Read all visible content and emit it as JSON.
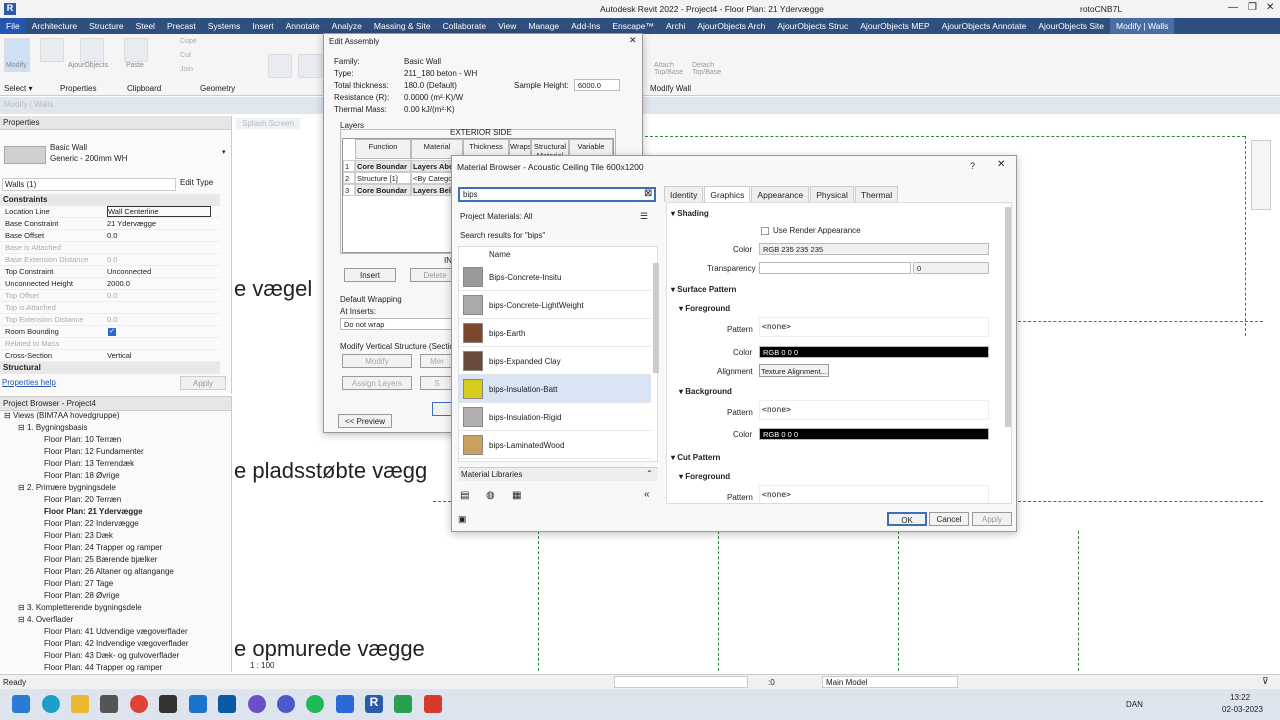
{
  "window": {
    "title": "Autodesk Revit 2022 - Project4 - Floor Plan: 21 Ydervægge",
    "user": "rotoCNB7L"
  },
  "ribbon_tabs": [
    "File",
    "Architecture",
    "Structure",
    "Steel",
    "Precast",
    "Systems",
    "Insert",
    "Annotate",
    "Analyze",
    "Massing & Site",
    "Collaborate",
    "View",
    "Manage",
    "Add-Ins",
    "Enscape™",
    "Archi",
    "AjourObjects Arch",
    "AjourObjects Struc",
    "AjourObjects MEP",
    "AjourObjects Annotate",
    "AjourObjects Site",
    "Modify | Walls"
  ],
  "ribbon_panels": {
    "select": "Select ▾",
    "properties": "Properties",
    "clipboard": "Clipboard",
    "geometry": "Geometry",
    "modify_wall": "Modify Wall",
    "modify": "Modify",
    "ajour": "AjourObjects",
    "paste": "Paste",
    "cope": "Cope",
    "cut": "Cut",
    "join": "Join",
    "attach": "Attach Top/Base",
    "detach": "Detach Top/Base"
  },
  "context_bar": "Modify | Walls",
  "properties": {
    "header": "Properties",
    "type_name": "Basic Wall",
    "type_sub": "Generic - 200mm WH",
    "selector": "Walls (1)",
    "edit_type": "Edit Type",
    "section_constraints": "Constraints",
    "rows": [
      {
        "k": "Location Line",
        "v": "Wall Centerline",
        "dis": false
      },
      {
        "k": "Base Constraint",
        "v": "21 Ydervægge",
        "dis": false
      },
      {
        "k": "Base Offset",
        "v": "0.0",
        "dis": false
      },
      {
        "k": "Base is Attached",
        "v": "",
        "dis": true
      },
      {
        "k": "Base Extension Distance",
        "v": "0.0",
        "dis": true
      },
      {
        "k": "Top Constraint",
        "v": "Unconnected",
        "dis": false
      },
      {
        "k": "Unconnected Height",
        "v": "2000.0",
        "dis": false
      },
      {
        "k": "Top Offset",
        "v": "0.0",
        "dis": true
      },
      {
        "k": "Top is Attached",
        "v": "",
        "dis": true
      },
      {
        "k": "Top Extension Distance",
        "v": "0.0",
        "dis": true
      },
      {
        "k": "Room Bounding",
        "v": "",
        "dis": false
      },
      {
        "k": "Related to Mass",
        "v": "",
        "dis": true
      },
      {
        "k": "Cross-Section",
        "v": "Vertical",
        "dis": false
      }
    ],
    "section_structural": "Structural",
    "help": "Properties help",
    "apply": "Apply"
  },
  "browser": {
    "header": "Project Browser - Project4",
    "root": "Views (BIM7AA hovedgruppe)",
    "items": [
      {
        "t": "1. Bygningsbasis",
        "lvl": 1
      },
      {
        "t": "Floor Plan: 10 Terræn",
        "lvl": 2
      },
      {
        "t": "Floor Plan: 12 Fundamenter",
        "lvl": 2
      },
      {
        "t": "Floor Plan: 13 Terrendæk",
        "lvl": 2
      },
      {
        "t": "Floor Plan: 18 Øvrige",
        "lvl": 2
      },
      {
        "t": "2. Primære bygningsdele",
        "lvl": 1
      },
      {
        "t": "Floor Plan: 20 Terræn",
        "lvl": 2
      },
      {
        "t": "Floor Plan: 21 Ydervægge",
        "lvl": 2,
        "bold": true
      },
      {
        "t": "Floor Plan: 22 Indervægge",
        "lvl": 2
      },
      {
        "t": "Floor Plan: 23 Dæk",
        "lvl": 2
      },
      {
        "t": "Floor Plan: 24 Trapper og ramper",
        "lvl": 2
      },
      {
        "t": "Floor Plan: 25 Bærende bjælker",
        "lvl": 2
      },
      {
        "t": "Floor Plan: 26 Altaner og altangange",
        "lvl": 2
      },
      {
        "t": "Floor Plan: 27 Tage",
        "lvl": 2
      },
      {
        "t": "Floor Plan: 28 Øvrige",
        "lvl": 2
      },
      {
        "t": "3. Kompletterende bygningsdele",
        "lvl": 1
      },
      {
        "t": "4. Overflader",
        "lvl": 1
      },
      {
        "t": "Floor Plan: 41 Udvendige vægoverflader",
        "lvl": 2
      },
      {
        "t": "Floor Plan: 42 Indvendige vægoverflader",
        "lvl": 2
      },
      {
        "t": "Floor Plan: 43 Dæk- og gulvoverflader",
        "lvl": 2
      },
      {
        "t": "Floor Plan: 44 Trapper og ramper",
        "lvl": 2
      }
    ]
  },
  "canvas": {
    "text1": "e vægel",
    "text2": "e pladsstøbte vægg",
    "text3": "e opmurede vægge",
    "splash": "Splash Screen"
  },
  "edit_assembly": {
    "title": "Edit Assembly",
    "family_k": "Family:",
    "family_v": "Basic Wall",
    "type_k": "Type:",
    "type_v": "211_180 beton - WH",
    "thick_k": "Total thickness:",
    "thick_v": "180.0 (Default)",
    "res_k": "Resistance (R):",
    "res_v": "0.0000 (m²·K)/W",
    "mass_k": "Thermal Mass:",
    "mass_v": "0.00 kJ/(m²·K)",
    "sample_k": "Sample Height:",
    "sample_v": "6000.0",
    "layers": "Layers",
    "exterior": "EXTERIOR SIDE",
    "cols": [
      "Function",
      "Material",
      "Thickness",
      "Wraps",
      "Structural Material",
      "Variable"
    ],
    "rows": [
      [
        "1",
        "Core Boundar",
        "Layers Abov"
      ],
      [
        "2",
        "Structure [1]",
        "<By Categor"
      ],
      [
        "3",
        "Core Boundar",
        "Layers Belo"
      ]
    ],
    "interior": "IN",
    "insert": "Insert",
    "delete": "Delete",
    "default_wrapping": "Default Wrapping",
    "at_inserts": "At Inserts:",
    "do_not_wrap": "Do not wrap",
    "mod_vert": "Modify Vertical Structure (Section P",
    "modify": "Modify",
    "merge": "Mer",
    "assign": "Assign Layers",
    "split": "S",
    "preview": "<< Preview"
  },
  "material_browser": {
    "title": "Material Browser - Acoustic Ceiling Tile 600x1200",
    "help": "?",
    "search_value": "bips",
    "filter": "Project Materials: All",
    "results_label": "Search results for \"bips\"",
    "name_col": "Name",
    "materials": [
      {
        "name": "Bips-Concrete-Insitu",
        "color": "#9a9a9a"
      },
      {
        "name": "bips-Concrete-LightWeight",
        "color": "#a9a9a9"
      },
      {
        "name": "bips-Earth",
        "color": "#7a4a2a"
      },
      {
        "name": "bips-Expanded Clay",
        "color": "#6a4a3a"
      },
      {
        "name": "bips-Insulation-Batt",
        "color": "#d6cc1a"
      },
      {
        "name": "bips-Insulation-Rigid",
        "color": "#b0b0b0"
      },
      {
        "name": "bips-LaminatedWood",
        "color": "#c8a060"
      }
    ],
    "selected_index": 4,
    "libraries": "Material Libraries",
    "tabs": [
      "Identity",
      "Graphics",
      "Appearance",
      "Physical",
      "Thermal"
    ],
    "active_tab": "Graphics",
    "shading": "Shading",
    "use_render": "Use Render Appearance",
    "color_k": "Color",
    "shading_color": "RGB 235 235 235",
    "transparency_k": "Transparency",
    "transparency_v": "0",
    "surface_pattern": "Surface Pattern",
    "foreground": "Foreground",
    "background": "Background",
    "pattern_k": "Pattern",
    "none": "<none>",
    "rgb000": "RGB 0 0 0",
    "alignment_k": "Alignment",
    "texture_alignment": "Texture Alignment...",
    "cut_pattern": "Cut Pattern",
    "ok": "OK",
    "cancel": "Cancel",
    "apply": "Apply"
  },
  "statusbar": {
    "ready": "Ready",
    "scale": "1 : 100",
    "zero": ":0",
    "model": "Main Model"
  },
  "taskbar": {
    "lang": "DAN",
    "time": "13:22",
    "date": "02-03-2023"
  },
  "colors": {
    "tabs": "#2f4f7f",
    "accent": "#3c6fb7",
    "selected_row": "#d9e5f4",
    "dashed": "#2a8a3a"
  }
}
